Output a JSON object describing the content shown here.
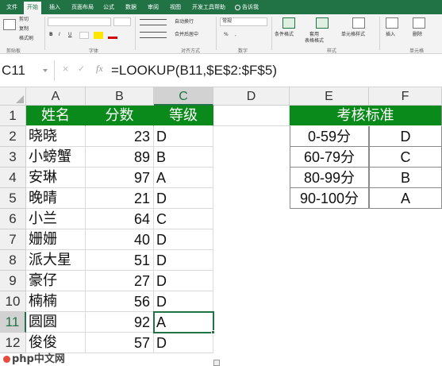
{
  "ribbon": {
    "tabs": [
      "文件",
      "开始",
      "插入",
      "页面布局",
      "公式",
      "数据",
      "审阅",
      "视图",
      "开发工具",
      "帮助"
    ],
    "active_tab": "开始",
    "search_label": "告诉我",
    "items": {
      "cut": "剪切",
      "copy": "复制",
      "format_painter": "格式刷",
      "bold": "B",
      "italic": "I",
      "underline": "U",
      "wrap_text": "自动换行",
      "merge_center": "合并后居中",
      "general": "常规",
      "percent": "%",
      "comma": ",",
      "conditional_format": "条件格式",
      "table_format": "套用\n表格格式",
      "cell_styles": "单元格样式",
      "insert": "插入",
      "delete": "删除"
    },
    "groups": [
      "剪贴板",
      "字体",
      "对齐方式",
      "数字",
      "样式",
      "单元格"
    ]
  },
  "formula_bar": {
    "name_box": "C11",
    "cancel_glyph": "×",
    "enter_glyph": "✓",
    "fx_glyph": "fx",
    "formula": "=LOOKUP(B11,$E$2:$F$5)"
  },
  "columns": [
    "A",
    "B",
    "C",
    "D",
    "E",
    "F"
  ],
  "rows": [
    "1",
    "2",
    "3",
    "4",
    "5",
    "6",
    "7",
    "8",
    "9",
    "10",
    "11",
    "12"
  ],
  "table": {
    "headers": [
      "姓名",
      "分数",
      "等级"
    ],
    "records": [
      [
        "晓晓",
        "23",
        "D"
      ],
      [
        "小螃蟹",
        "89",
        "B"
      ],
      [
        "安琳",
        "97",
        "A"
      ],
      [
        "晚晴",
        "21",
        "D"
      ],
      [
        "小兰",
        "64",
        "C"
      ],
      [
        "姗姗",
        "40",
        "D"
      ],
      [
        "派大星",
        "51",
        "D"
      ],
      [
        "豪仔",
        "27",
        "D"
      ],
      [
        "楠楠",
        "56",
        "D"
      ],
      [
        "圆圆",
        "92",
        "A"
      ],
      [
        "俊俊",
        "57",
        "D"
      ]
    ]
  },
  "criteria": {
    "title": "考核标准",
    "rows": [
      [
        "0-59分",
        "D"
      ],
      [
        "60-79分",
        "C"
      ],
      [
        "80-99分",
        "B"
      ],
      [
        "90-100分",
        "A"
      ]
    ]
  },
  "watermark": "php中文网",
  "colors": {
    "header_green": "#0a8a1b",
    "excel_green": "#217346"
  }
}
